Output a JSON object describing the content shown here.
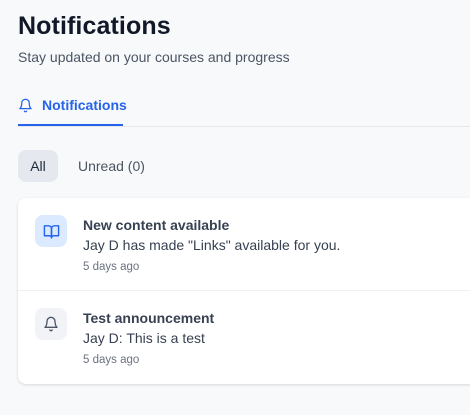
{
  "header": {
    "title": "Notifications",
    "subtitle": "Stay updated on your courses and progress"
  },
  "tabs": [
    {
      "label": "Notifications",
      "icon": "bell-icon",
      "active": true
    }
  ],
  "filters": {
    "all_label": "All",
    "unread_label": "Unread (0)",
    "selected": "All"
  },
  "notifications": [
    {
      "icon": "book-icon",
      "title": "New content available",
      "body": "Jay D has made \"Links\" available for you.",
      "time": "5 days ago"
    },
    {
      "icon": "bell-icon",
      "title": "Test announcement",
      "body": "Jay D: This is a test",
      "time": "5 days ago"
    }
  ],
  "colors": {
    "accent": "#2563eb",
    "background": "#f8f9fb",
    "card": "#ffffff",
    "icon_blue_bg": "#dbeafe",
    "icon_gray_bg": "#f1f3f6"
  }
}
